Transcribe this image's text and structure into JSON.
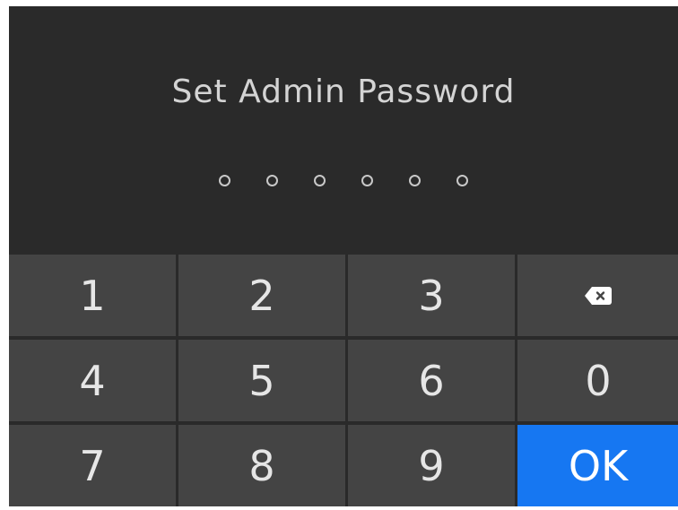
{
  "title": "Set Admin Password",
  "password": {
    "length": 6,
    "entered": 0
  },
  "keypad": {
    "k1": "1",
    "k2": "2",
    "k3": "3",
    "k4": "4",
    "k5": "5",
    "k6": "6",
    "k7": "7",
    "k8": "8",
    "k9": "9",
    "k0": "0",
    "backspace_icon": "backspace-icon",
    "ok": "OK"
  },
  "colors": {
    "background": "#2a2a2a",
    "key": "#444444",
    "accent": "#1677f2",
    "text": "#e6e6e6"
  }
}
